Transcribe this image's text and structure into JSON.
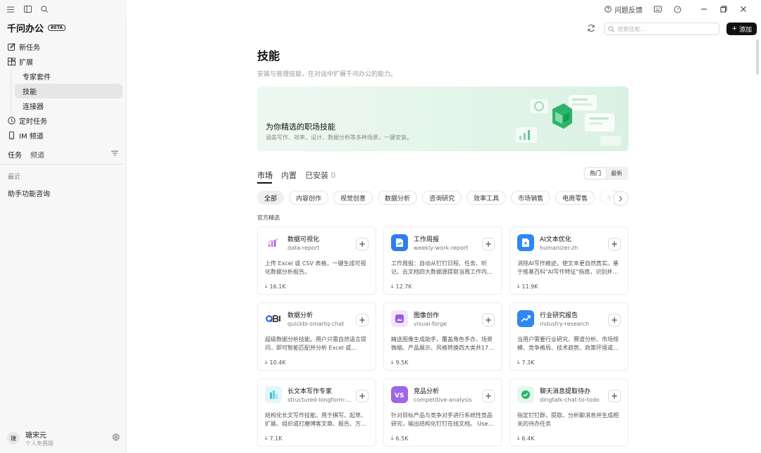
{
  "titlebar": {
    "feedback_label": "问题反馈"
  },
  "sidebar": {
    "brand": "千问办公",
    "beta": "BETA",
    "nav": {
      "new_task": "新任务",
      "extensions": "扩展",
      "expert_kits": "专家套件",
      "skills": "技能",
      "connectors": "连接器",
      "scheduled": "定时任务",
      "im": "IM 频道"
    },
    "tabs": {
      "tasks": "任务",
      "channels": "频道"
    },
    "recent_label": "最近",
    "recent_items": [
      "助手功能咨询"
    ],
    "user": {
      "name": "瑭宋元",
      "plan": "个人免费版",
      "avatar": "瑭"
    }
  },
  "topbar": {
    "search_placeholder": "搜索技能...",
    "add_label": "添加"
  },
  "page": {
    "title": "技能",
    "subtitle": "安装与管理技能，在对话中扩展千问办公的能力。"
  },
  "banner": {
    "title": "为你精选的职场技能",
    "subtitle": "涵盖写作、效率、设计、数据分析等多种场景，一键安装。"
  },
  "tabs": {
    "market": "市场",
    "builtin": "内置",
    "installed": "已安装",
    "installed_count": "0"
  },
  "sort": {
    "hot": "热门",
    "new": "最新"
  },
  "chips": [
    "全部",
    "内容创作",
    "视觉创意",
    "数据分析",
    "咨询研究",
    "效率工具",
    "市场销售",
    "电商零售",
    "平"
  ],
  "section_label": "官方精选",
  "cards": [
    {
      "name": "数据可视化",
      "id": "data-report",
      "desc": "上传 Excel 或 CSV 表格，一键生成可视化数据分析报告。",
      "downloads": "16.1K",
      "icon": "chart-bars-icon",
      "color": "#ffffff"
    },
    {
      "name": "工作周报",
      "id": "weekly-work-report",
      "desc": "工作周报：自动从钉钉日程、任务、听记、云文档四大数据源提取当周工作内容，多...",
      "downloads": "12.7K",
      "icon": "document-chart-icon",
      "color": "#2f7bf5"
    },
    {
      "name": "AI文本优化",
      "id": "humanizer-zh",
      "desc": "消除AI写作痕迹，使文本更自然真实。基于维基百科\"AI写作特征\"指南，识别并修正...",
      "downloads": "11.9K",
      "icon": "sparkle-doc-icon",
      "color": "#2f86f5"
    },
    {
      "name": "数据分析",
      "id": "quickbi-smartq-chat",
      "desc": "超级数据分析技能。用户只需自然语言提问，即可智能匹配并分析 Excel 或 Quick...",
      "downloads": "10.4K",
      "icon": "qbi-logo-icon",
      "color": "#ffffff"
    },
    {
      "name": "图像创作",
      "id": "visual-forge",
      "desc": "精选图像生成助手，覆盖角色手办、场景微缩、产品展示、风格转换四大类共17种风...",
      "downloads": "9.5K",
      "icon": "image-icon",
      "color": "#9b59e6"
    },
    {
      "name": "行业研究报告",
      "id": "industry-research",
      "desc": "当用户需要行业研究、赛道分析、市场规模、竞争格局、技术趋势、政策环境或投...",
      "downloads": "7.3K",
      "icon": "trend-up-icon",
      "color": "#2f86f5"
    },
    {
      "name": "长文本写作专家",
      "id": "structured-longform-...",
      "desc": "结构化长文写作技能。用于撰写、起草、扩展、组织或打磨博客文章、报告、方案、...",
      "downloads": "7.1K",
      "icon": "long-doc-icon",
      "color": "#e2f6fb"
    },
    {
      "name": "竞品分析",
      "id": "competitive-analysis",
      "desc": "针对目标产品与竞争对手进行系统性竞品研究，输出结构化钉钉在线文档。 Use wh...",
      "downloads": "6.5K",
      "icon": "vs-icon",
      "color": "#a066e8"
    },
    {
      "name": "聊天消息提取待办",
      "id": "dingtalk-chat-to-todo",
      "desc": "指定钉钉群，提取、分析聊消息并生成相关的待办任务",
      "downloads": "6.4K",
      "icon": "chat-todo-icon",
      "color": "#e6f7ec"
    }
  ]
}
